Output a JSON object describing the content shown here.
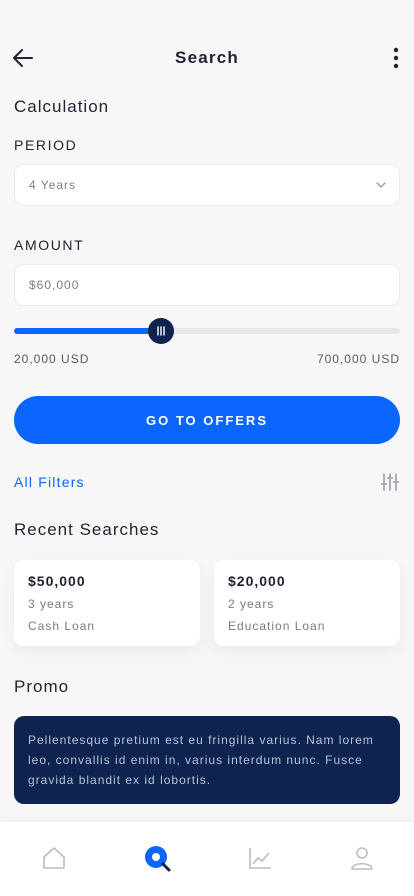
{
  "header": {
    "title": "Search"
  },
  "calculation": {
    "title": "Calculation",
    "period_label": "PERIOD",
    "period_value": "4 Years",
    "amount_label": "AMOUNT",
    "amount_value": "$60,000",
    "slider": {
      "min_label": "20,000 USD",
      "max_label": "700,000 USD",
      "level_fraction": 0.38
    }
  },
  "cta": {
    "label": "GO TO OFFERS"
  },
  "filters": {
    "label": "All Filters"
  },
  "recent": {
    "title": "Recent Searches",
    "items": [
      {
        "amount": "$50,000",
        "years": "3 years",
        "type": "Cash Loan"
      },
      {
        "amount": "$20,000",
        "years": "2 years",
        "type": "Education Loan"
      }
    ]
  },
  "promo": {
    "title": "Promo",
    "text": "Pellentesque pretium est eu fringilla varius. Nam lorem leo, convallis id enim in, varius interdum nunc. Fusce gravida blandit ex id lobortis."
  },
  "tabs": [
    {
      "icon": "home-icon",
      "active": false
    },
    {
      "icon": "search-icon",
      "active": true
    },
    {
      "icon": "chart-icon",
      "active": false
    },
    {
      "icon": "profile-icon",
      "active": false
    }
  ],
  "colors": {
    "accent": "#0a66ff",
    "navy": "#0f2350",
    "background": "#f7f7f7"
  }
}
